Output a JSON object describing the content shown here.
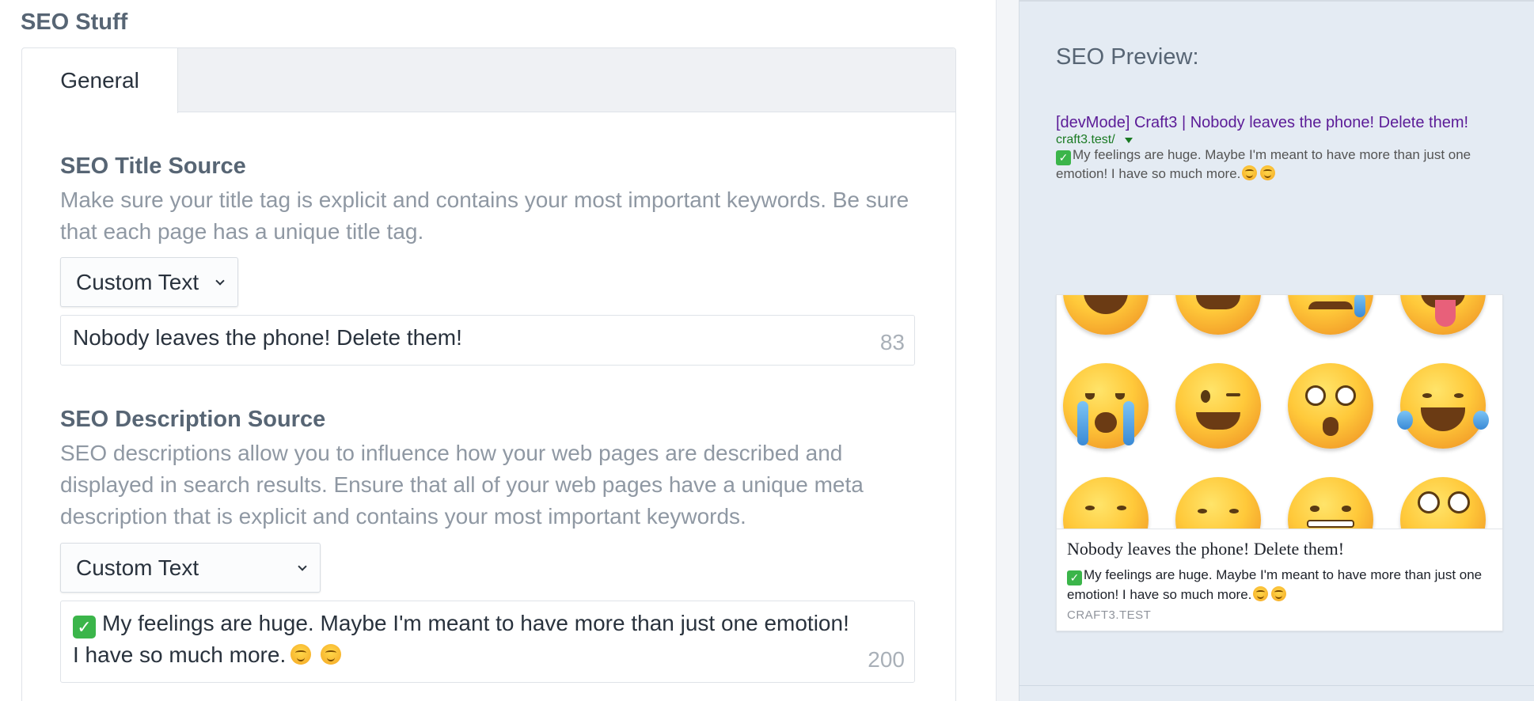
{
  "section_title": "SEO Stuff",
  "tabs": [
    {
      "label": "General",
      "active": true
    }
  ],
  "title_field": {
    "heading": "SEO Title Source",
    "instructions": "Make sure your title tag is explicit and contains your most important keywords. Be sure that each page has a unique title tag.",
    "source_select": "Custom Text",
    "value": "Nobody leaves the phone! Delete them!",
    "remaining": "83"
  },
  "description_field": {
    "heading": "SEO Description Source",
    "instructions": "SEO descriptions allow you to influence how your web pages are described and displayed in search results. Ensure that all of your web pages have a unique meta description that is explicit and contains your most important keywords.",
    "source_select": "Custom Text",
    "value_text": "My feelings are huge. Maybe I'm meant to have more than just one emotion! I have so much more.",
    "remaining": "200"
  },
  "preview": {
    "heading": "SEO Preview:",
    "serp": {
      "title": "[devMode] Craft3 | Nobody leaves the phone! Delete them!",
      "url": "craft3.test/",
      "description": "My feelings are huge. Maybe I'm meant to have more than just one emotion! I have so much more."
    },
    "card": {
      "title": "Nobody leaves the phone! Delete them!",
      "description": "My feelings are huge. Maybe I'm meant to have more than just one emotion! I have so much more.",
      "domain": "CRAFT3.TEST"
    }
  },
  "colors": {
    "serp_title": "#5b1b97",
    "serp_url": "#1a7a23",
    "preview_bg": "#e4ebf3",
    "heading": "#576574",
    "instructions": "#8f98a3"
  },
  "icons": [
    "check-mark-emoji",
    "yum-face-emoji",
    "chevron-down-icon",
    "dropdown-triangle-icon"
  ]
}
